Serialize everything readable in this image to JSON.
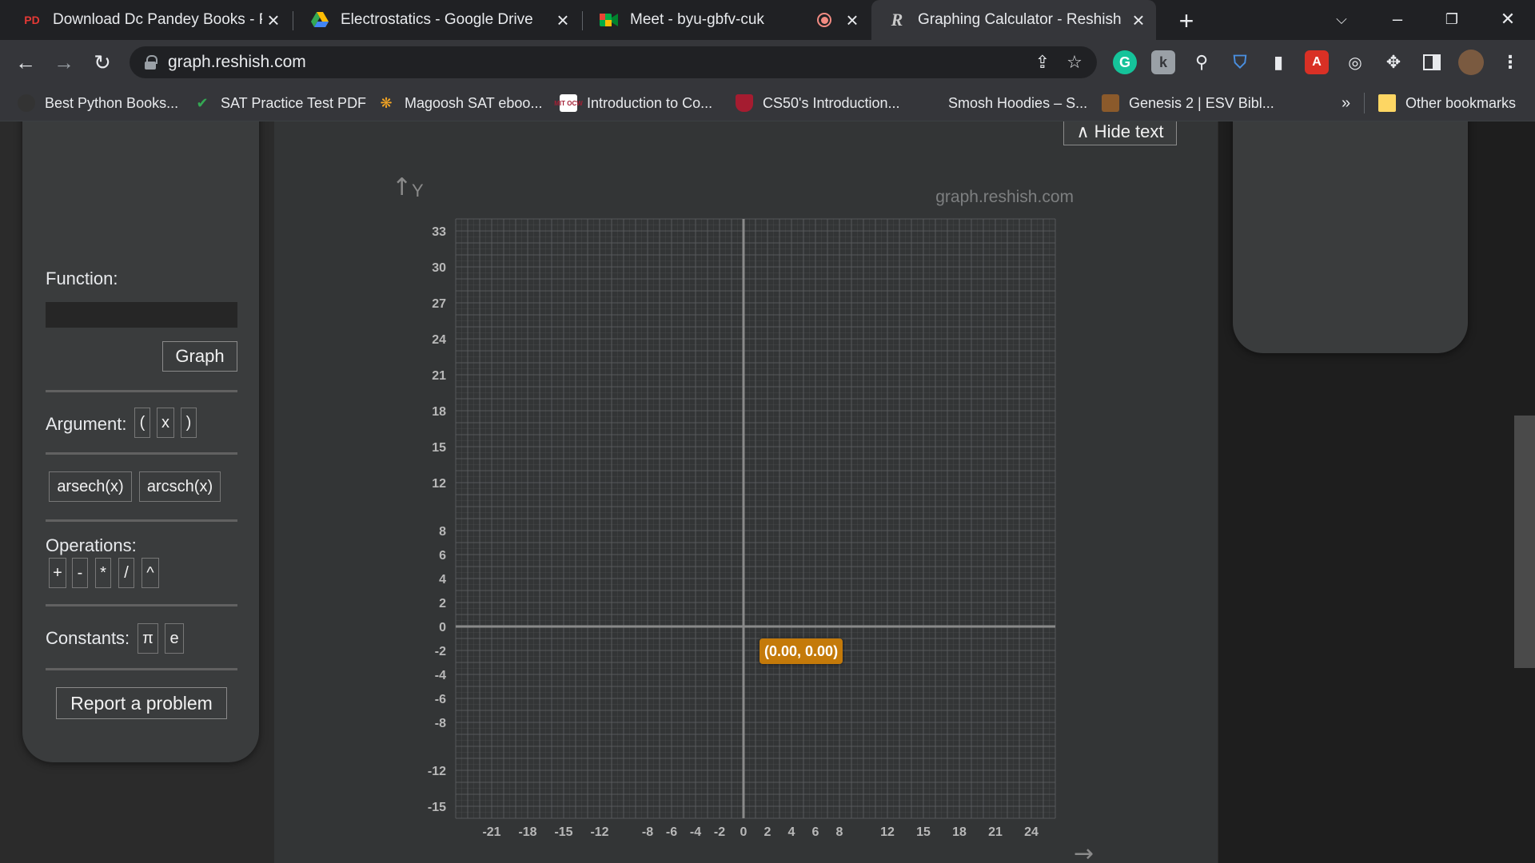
{
  "tabs": [
    {
      "label": "Download Dc Pandey Books - PD",
      "favicon": "PD"
    },
    {
      "label": "Electrostatics - Google Drive",
      "favicon": "drive-icon"
    },
    {
      "label": "Meet - byu-gbfv-cuk",
      "favicon": "meet-icon"
    },
    {
      "label": "Graphing Calculator - Reshish",
      "favicon": "R"
    }
  ],
  "address_bar": {
    "url": "graph.reshish.com"
  },
  "bookmarks": [
    {
      "label": "Best Python Books..."
    },
    {
      "label": "SAT Practice Test PDF"
    },
    {
      "label": "Magoosh SAT eboo..."
    },
    {
      "label": "Introduction to Co...",
      "icon": "MIT OCW"
    },
    {
      "label": "CS50's Introduction..."
    },
    {
      "label": "Smosh Hoodies – S..."
    },
    {
      "label": "Genesis 2 | ESV Bibl..."
    }
  ],
  "bookmarks_overflow": "»",
  "other_bookmarks": "Other bookmarks",
  "panel": {
    "function_label": "Function:",
    "function_value": "",
    "graph_button": "Graph",
    "argument_label": "Argument:",
    "argument_buttons": [
      "(",
      "x",
      ")"
    ],
    "func_buttons": [
      "arsech(x)",
      "arcsch(x)"
    ],
    "operations_label": "Operations:",
    "operation_buttons": [
      "+",
      "-",
      "*",
      "/",
      "^"
    ],
    "constants_label": "Constants:",
    "constant_buttons": [
      "π",
      "e"
    ],
    "report_button": "Report a problem"
  },
  "hide_text_button": "∧ Hide text",
  "chart_data": {
    "type": "line",
    "watermark": "graph.reshish.com",
    "ylabel": "Y",
    "x_ticks": [
      -21,
      -18,
      -15,
      -12,
      -8,
      -6,
      -4,
      -2,
      0,
      2,
      4,
      6,
      8,
      12,
      15,
      18,
      21,
      24
    ],
    "y_ticks": [
      33,
      30,
      27,
      24,
      21,
      18,
      15,
      12,
      8,
      6,
      4,
      2,
      0,
      -2,
      -4,
      -6,
      -8,
      -12,
      -15
    ],
    "xlim": [
      -24,
      26
    ],
    "ylim": [
      -16,
      34
    ],
    "grid": true,
    "cursor_label": "(0.00, 0.00)",
    "series": []
  },
  "colors": {
    "tooltip": "#c47a0a",
    "grid": "#5a5c5d",
    "axis": "#8a8a8a"
  }
}
